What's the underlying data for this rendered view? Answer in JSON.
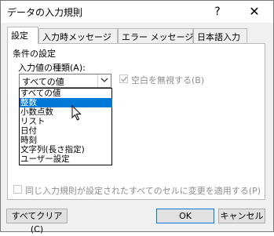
{
  "window": {
    "title": "データの入力規則",
    "help_glyph": "?",
    "close_glyph": "✕"
  },
  "tabs": [
    {
      "label": "設定",
      "active": true
    },
    {
      "label": "入力時メッセージ",
      "active": false
    },
    {
      "label": "エラー メッセージ",
      "active": false
    },
    {
      "label": "日本語入力",
      "active": false
    }
  ],
  "settings": {
    "section_label": "条件の設定",
    "field_label": "入力値の種類(A):",
    "selected_value": "すべての値",
    "ignore_blank_label": "空白を無視する(B)",
    "ignore_blank_checked": true,
    "apply_all_label": "同じ入力規則が設定されたすべてのセルに変更を適用する(P)",
    "apply_all_checked": false
  },
  "dropdown": {
    "options": [
      "すべての値",
      "整数",
      "小数点数",
      "リスト",
      "日付",
      "時刻",
      "文字列(長さ指定)",
      "ユーザー設定"
    ],
    "highlighted_index": 1
  },
  "buttons": {
    "clear_all": "すべてクリア(C)",
    "ok": "OK",
    "cancel": "キャンセル"
  },
  "colors": {
    "highlight": "#0078d7",
    "disabled_text": "#8d8d8d"
  },
  "icons": {
    "dropdown_arrow": "chevron-down-icon",
    "checkmark": "checkmark-icon",
    "cursor": "mouse-pointer-icon"
  }
}
